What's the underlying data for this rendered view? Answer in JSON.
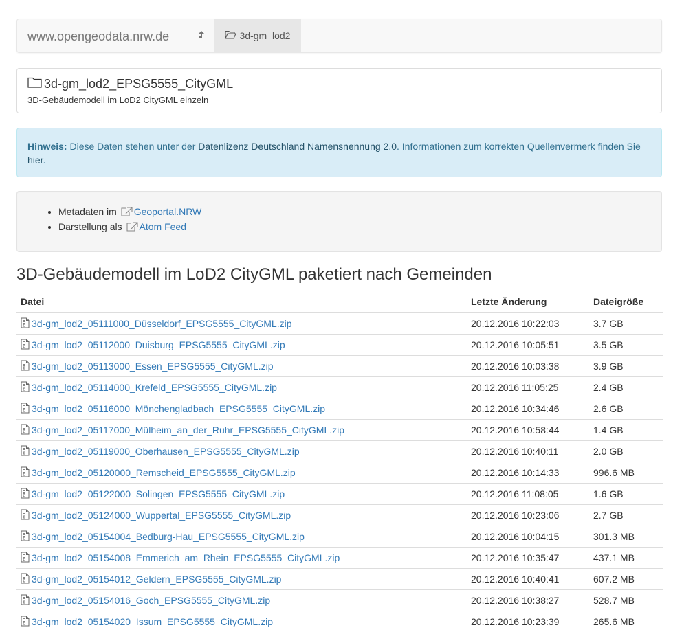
{
  "navbar": {
    "brand": "www.opengeodata.nrw.de",
    "up_icon": "arrow-up-icon",
    "active_folder": "3d-gm_lod2"
  },
  "dataset": {
    "title": "3d-gm_lod2_EPSG5555_CityGML",
    "description": "3D-Gebäudemodell im LoD2 CityGML einzeln"
  },
  "notice": {
    "label": "Hinweis:",
    "text_before": " Diese Daten stehen unter der ",
    "license_link": "Datenlizenz Deutschland Namensnennung 2.0",
    "text_after": ". Informationen zum korrekten Quellenvermerk finden Sie ",
    "here_link": "hier",
    "end": "."
  },
  "meta": {
    "items": [
      {
        "prefix": "Metadaten im ",
        "link": "Geoportal.NRW"
      },
      {
        "prefix": "Darstellung als ",
        "link": "Atom Feed"
      }
    ]
  },
  "section_title": "3D-Gebäudemodell im LoD2 CityGML paketiert nach Gemeinden",
  "table": {
    "headers": [
      "Datei",
      "Letzte Änderung",
      "Dateigröße"
    ],
    "rows": [
      {
        "name": "3d-gm_lod2_05111000_Düsseldorf_EPSG5555_CityGML.zip",
        "date": "20.12.2016 10:22:03",
        "size": "3.7 GB"
      },
      {
        "name": "3d-gm_lod2_05112000_Duisburg_EPSG5555_CityGML.zip",
        "date": "20.12.2016 10:05:51",
        "size": "3.5 GB"
      },
      {
        "name": "3d-gm_lod2_05113000_Essen_EPSG5555_CityGML.zip",
        "date": "20.12.2016 10:03:38",
        "size": "3.9 GB"
      },
      {
        "name": "3d-gm_lod2_05114000_Krefeld_EPSG5555_CityGML.zip",
        "date": "20.12.2016 11:05:25",
        "size": "2.4 GB"
      },
      {
        "name": "3d-gm_lod2_05116000_Mönchengladbach_EPSG5555_CityGML.zip",
        "date": "20.12.2016 10:34:46",
        "size": "2.6 GB"
      },
      {
        "name": "3d-gm_lod2_05117000_Mülheim_an_der_Ruhr_EPSG5555_CityGML.zip",
        "date": "20.12.2016 10:58:44",
        "size": "1.4 GB"
      },
      {
        "name": "3d-gm_lod2_05119000_Oberhausen_EPSG5555_CityGML.zip",
        "date": "20.12.2016 10:40:11",
        "size": "2.0 GB"
      },
      {
        "name": "3d-gm_lod2_05120000_Remscheid_EPSG5555_CityGML.zip",
        "date": "20.12.2016 10:14:33",
        "size": "996.6 MB"
      },
      {
        "name": "3d-gm_lod2_05122000_Solingen_EPSG5555_CityGML.zip",
        "date": "20.12.2016 11:08:05",
        "size": "1.6 GB"
      },
      {
        "name": "3d-gm_lod2_05124000_Wuppertal_EPSG5555_CityGML.zip",
        "date": "20.12.2016 10:23:06",
        "size": "2.7 GB"
      },
      {
        "name": "3d-gm_lod2_05154004_Bedburg-Hau_EPSG5555_CityGML.zip",
        "date": "20.12.2016 10:04:15",
        "size": "301.3 MB"
      },
      {
        "name": "3d-gm_lod2_05154008_Emmerich_am_Rhein_EPSG5555_CityGML.zip",
        "date": "20.12.2016 10:35:47",
        "size": "437.1 MB"
      },
      {
        "name": "3d-gm_lod2_05154012_Geldern_EPSG5555_CityGML.zip",
        "date": "20.12.2016 10:40:41",
        "size": "607.2 MB"
      },
      {
        "name": "3d-gm_lod2_05154016_Goch_EPSG5555_CityGML.zip",
        "date": "20.12.2016 10:38:27",
        "size": "528.7 MB"
      },
      {
        "name": "3d-gm_lod2_05154020_Issum_EPSG5555_CityGML.zip",
        "date": "20.12.2016 10:23:39",
        "size": "265.6 MB"
      }
    ]
  },
  "icons": {
    "folder": "folder-icon",
    "folder_open": "folder-open-icon",
    "external_link": "external-link-icon",
    "file_zip": "file-zip-icon"
  },
  "colors": {
    "link": "#337ab7",
    "alert_bg": "#d9edf7",
    "alert_text": "#31708f"
  }
}
